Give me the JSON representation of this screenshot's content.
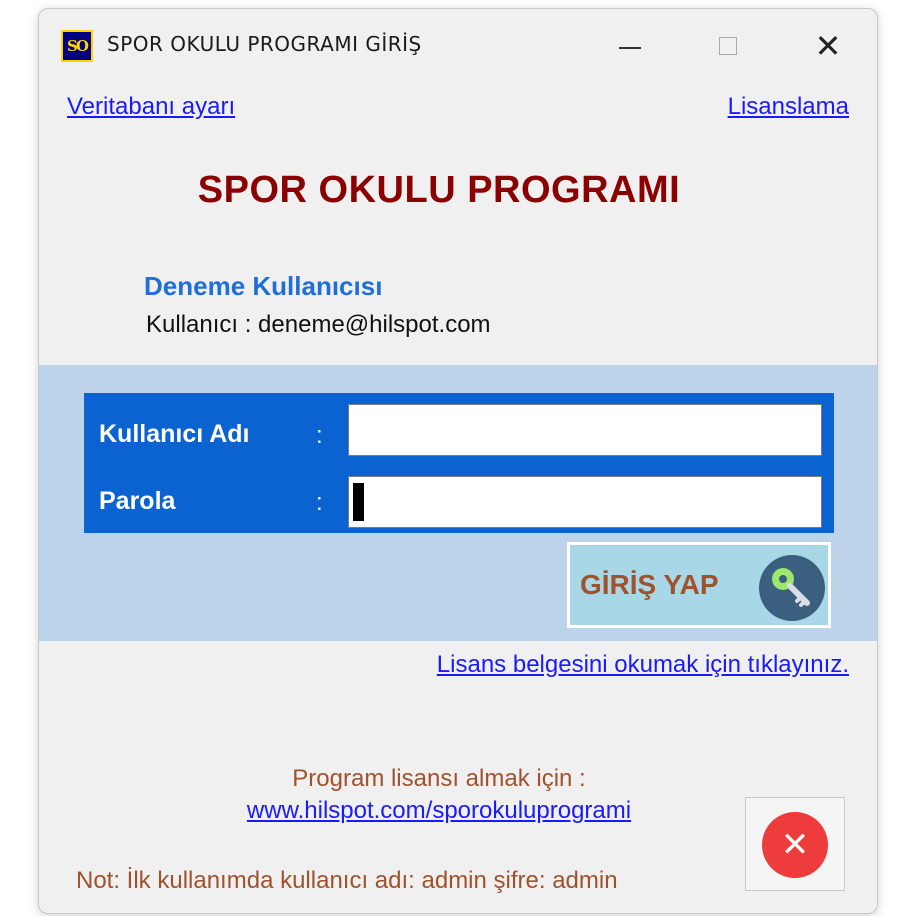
{
  "window": {
    "title": "SPOR OKULU PROGRAMI GİRİŞ",
    "icon_text": "SO",
    "close_glyph": "✕"
  },
  "links": {
    "database_settings": "Veritabanı ayarı",
    "licensing": "Lisanslama",
    "read_license": "Lisans belgesini okumak için tıklayınız.",
    "website": "www.hilspot.com/sporokuluprogrami"
  },
  "app_title": "SPOR OKULU PROGRAMI",
  "user": {
    "display_name": "Deneme Kullanıcısı",
    "account_line": "Kullanıcı : deneme@hilspot.com"
  },
  "login_form": {
    "username_label": "Kullanıcı Adı",
    "password_label": "Parola",
    "separator": ":",
    "username_value": "",
    "password_value": "",
    "submit_label": "GİRİŞ YAP"
  },
  "footer": {
    "license_prompt": "Program lisansı almak için :",
    "note": "Not: İlk kullanımda kullanıcı adı: admin şifre: admin",
    "exit_glyph": "✕"
  },
  "icons": {
    "app": "app-logo-icon",
    "submit": "key-icon",
    "exit": "close-circle-icon"
  },
  "colors": {
    "title_red": "#8b0000",
    "user_blue": "#1e6fd9",
    "form_blue": "#0a63d1",
    "band": "#bcd3ea",
    "accent_brown": "#a0522d",
    "exit_red": "#ee3b3b"
  }
}
